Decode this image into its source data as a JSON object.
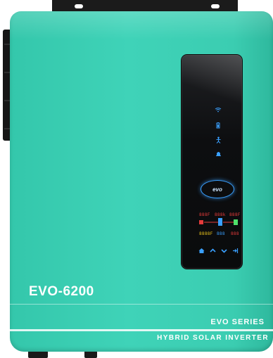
{
  "product": {
    "model": "EVO-6200",
    "series": "EVO SERIES",
    "subtitle": "HYBRID SOLAR INVERTER",
    "body_color": "#3ccfb4",
    "panel_color": "#0d0e10",
    "accent_color": "#3aa0ff"
  },
  "display": {
    "logo": "evo",
    "status_icons": [
      "wifi-icon",
      "battery-icon",
      "fault-icon",
      "bell-icon"
    ],
    "segment_readouts": [
      "888F",
      "888k",
      "888F",
      "8888F",
      "888",
      "888"
    ],
    "buttons": [
      "home-icon",
      "up-icon",
      "down-icon",
      "enter-icon"
    ]
  }
}
